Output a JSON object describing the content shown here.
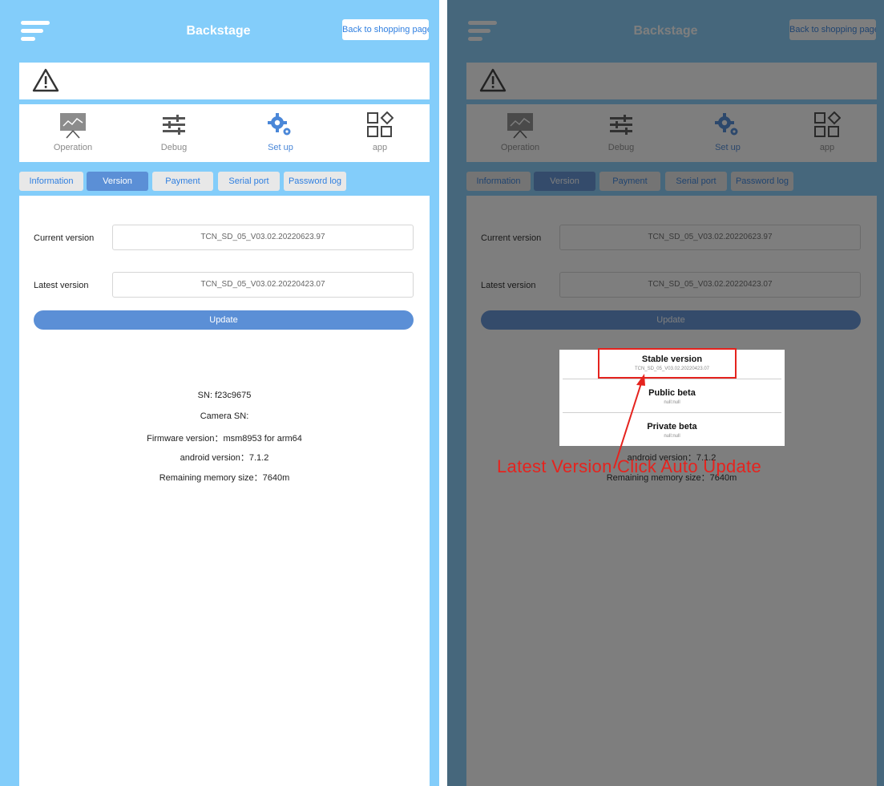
{
  "header": {
    "title": "Backstage",
    "back_button": "Back to shopping page"
  },
  "nav": {
    "items": [
      {
        "label": "Operation",
        "icon": "presentation-board-icon"
      },
      {
        "label": "Debug",
        "icon": "sliders-icon"
      },
      {
        "label": "Set up",
        "icon": "gears-icon",
        "active": true
      },
      {
        "label": "app",
        "icon": "app-grid-icon"
      }
    ]
  },
  "tabs": [
    "Information",
    "Version",
    "Payment",
    "Serial port",
    "Password log"
  ],
  "active_tab": "Version",
  "version": {
    "current_label": "Current version",
    "current_value": "TCN_SD_05_V03.02.20220623.97",
    "latest_label": "Latest version",
    "latest_value": "TCN_SD_05_V03.02.20220423.07",
    "update_button": "Update"
  },
  "device_info": {
    "sn": "SN: f23c9675",
    "camera_sn": "Camera SN:",
    "firmware": "Firmware version：msm8953 for arm64",
    "android": "android version：7.1.2",
    "memory": "Remaining memory size：7640m"
  },
  "dialog": {
    "options": [
      {
        "title": "Stable version",
        "sub": "TCN_SD_05_V03.02.20220423.07"
      },
      {
        "title": "Public beta",
        "sub": "null:null"
      },
      {
        "title": "Private beta",
        "sub": "null:null"
      }
    ]
  },
  "annotation": {
    "text": "Latest Version Click Auto Update"
  },
  "colors": {
    "brand_blue": "#83cdfa",
    "accent_blue": "#5b8fd6",
    "annotation_red": "#e5231e"
  }
}
